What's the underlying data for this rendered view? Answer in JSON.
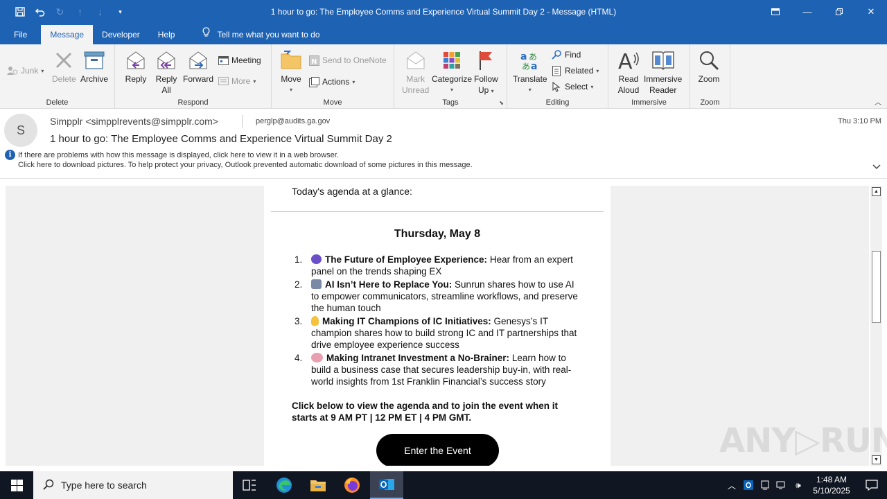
{
  "window": {
    "title": "1 hour to go: The Employee Comms and Experience Virtual Summit Day 2  -  Message (HTML)"
  },
  "menu_tabs": [
    "File",
    "Message",
    "Developer",
    "Help"
  ],
  "tell_me": "Tell me what you want to do",
  "ribbon": {
    "delete_group": {
      "label": "Delete",
      "junk": "Junk",
      "delete": "Delete",
      "archive": "Archive"
    },
    "respond_group": {
      "label": "Respond",
      "reply": "Reply",
      "reply_all_1": "Reply",
      "reply_all_2": "All",
      "forward": "Forward",
      "meeting": "Meeting",
      "more": "More"
    },
    "move_group": {
      "label": "Move",
      "move": "Move",
      "onenote": "Send to OneNote",
      "actions": "Actions"
    },
    "tags_group": {
      "label": "Tags",
      "mark_1": "Mark",
      "mark_2": "Unread",
      "categorize": "Categorize",
      "follow_1": "Follow",
      "follow_2": "Up"
    },
    "editing_group": {
      "label": "Editing",
      "translate": "Translate",
      "find": "Find",
      "related": "Related",
      "select": "Select"
    },
    "immersive_group": {
      "label": "Immersive",
      "read_1": "Read",
      "read_2": "Aloud",
      "immersive_1": "Immersive",
      "immersive_2": "Reader"
    },
    "zoom_group": {
      "label": "Zoom",
      "zoom": "Zoom"
    }
  },
  "message": {
    "avatar_initial": "S",
    "sender": "Simpplr <simpplrevents@simpplr.com>",
    "to": "perglp@audits.ga.gov",
    "date": "Thu 3:10 PM",
    "subject": "1 hour to go: The Employee Comms and Experience Virtual Summit Day 2",
    "info_line_1": "If there are problems with how this message is displayed, click here to view it in a web browser.",
    "info_line_2": "Click here to download pictures. To help protect your privacy, Outlook prevented automatic download of some pictures in this message."
  },
  "email_body": {
    "agenda_heading": "Today's agenda at a glance:",
    "day": "Thursday, May 8",
    "items": [
      {
        "num": "1.",
        "emoji_color": "#6b4fc9",
        "title": "The Future of Employee Experience:",
        "desc": " Hear from an expert panel on the trends shaping EX"
      },
      {
        "num": "2.",
        "emoji_color": "#7a8aa6",
        "title": "AI Isn’t Here to Replace You:",
        "desc": " Sunrun shares how to use AI to empower communicators, streamline workflows, and preserve the human touch"
      },
      {
        "num": "3.",
        "emoji_color": "#f5c33b",
        "title": "Making IT Champions of IC Initiatives:",
        "desc": " Genesys’s IT champion shares how to build strong IC and IT partnerships that drive employee experience success"
      },
      {
        "num": "4.",
        "emoji_color": "#e8a0b0",
        "title": "Making Intranet Investment a No-Brainer:",
        "desc": " Learn how to build a business case that secures leadership buy-in, with real-world insights from 1st Franklin Financial’s success story"
      }
    ],
    "cta_text": "Click below to view the agenda and to join the event when it starts at 9 AM PT | 12 PM ET | 4 PM GMT.",
    "cta_button": "Enter the Event"
  },
  "watermark": "ANY.RUN",
  "taskbar": {
    "search_placeholder": "Type here to search",
    "time": "1:48 AM",
    "date": "5/10/2025"
  }
}
